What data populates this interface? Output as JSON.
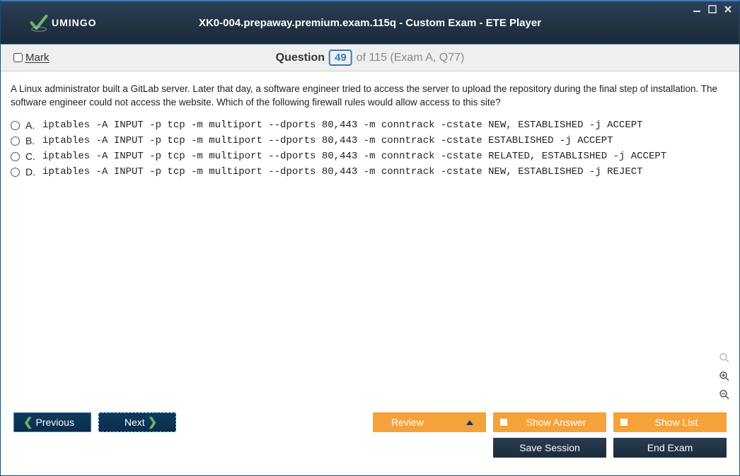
{
  "titlebar": {
    "brand": "UMINGO",
    "title": "XK0-004.prepaway.premium.exam.115q - Custom Exam - ETE Player"
  },
  "questionbar": {
    "mark_label": "Mark",
    "word": "Question",
    "number": "49",
    "rest": "of 115 (Exam A, Q77)"
  },
  "question": {
    "text": "A Linux administrator built a GitLab server. Later that day, a software engineer tried to access the server to upload the repository during the final step of installation. The software engineer could not access the website. Which of the following firewall rules would allow access to this site?",
    "options": [
      {
        "letter": "A.",
        "code": "iptables -A INPUT -p tcp -m multiport --dports 80,443 -m conntrack -cstate NEW, ESTABLISHED -j ACCEPT"
      },
      {
        "letter": "B.",
        "code": "iptables -A INPUT -p tcp -m multiport --dports 80,443 -m conntrack -cstate ESTABLISHED -j ACCEPT"
      },
      {
        "letter": "C.",
        "code": "iptables -A INPUT -p tcp -m multiport --dports 80,443 -m conntrack -cstate RELATED, ESTABLISHED -j ACCEPT"
      },
      {
        "letter": "D.",
        "code": "iptables -A INPUT -p tcp -m multiport --dports 80,443 -m conntrack -cstate NEW, ESTABLISHED -j REJECT"
      }
    ]
  },
  "footer": {
    "previous": "Previous",
    "next": "Next",
    "review": "Review",
    "show_answer": "Show Answer",
    "show_list": "Show List",
    "save_session": "Save Session",
    "end_exam": "End Exam"
  }
}
